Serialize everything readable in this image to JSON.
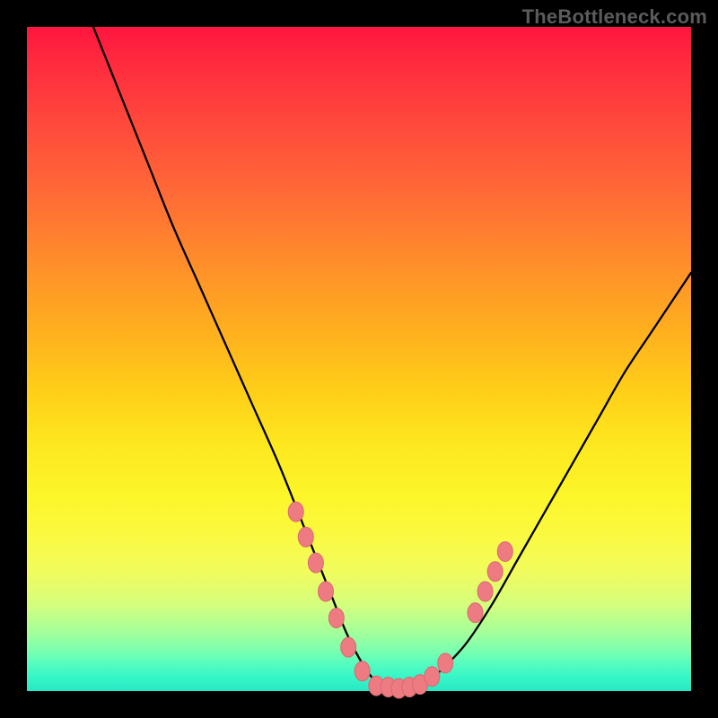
{
  "watermark": "TheBottleneck.com",
  "colors": {
    "frame": "#000000",
    "curve": "#000000",
    "marker_fill": "#ee7a82",
    "marker_stroke": "#d86a72"
  },
  "chart_data": {
    "type": "line",
    "title": "",
    "xlabel": "",
    "ylabel": "",
    "xlim": [
      0,
      100
    ],
    "ylim": [
      0,
      100
    ],
    "series": [
      {
        "name": "curve",
        "x": [
          10,
          14,
          18,
          22,
          26,
          30,
          34,
          38,
          42,
          44,
          46,
          48,
          50,
          52,
          54,
          56,
          58,
          60,
          62,
          66,
          70,
          74,
          78,
          82,
          86,
          90,
          94,
          98,
          100
        ],
        "y": [
          100,
          90,
          80,
          70,
          61,
          52,
          43,
          34,
          24,
          19,
          14,
          9,
          5,
          2,
          0.6,
          0.2,
          0.4,
          1.2,
          2.8,
          7,
          13,
          20,
          27,
          34,
          41,
          48,
          54,
          60,
          63
        ]
      }
    ],
    "markers": [
      {
        "x": 40.5,
        "y": 27.0
      },
      {
        "x": 42.0,
        "y": 23.2
      },
      {
        "x": 43.5,
        "y": 19.3
      },
      {
        "x": 45.0,
        "y": 15.0
      },
      {
        "x": 46.6,
        "y": 11.0
      },
      {
        "x": 48.4,
        "y": 6.6
      },
      {
        "x": 50.5,
        "y": 3.0
      },
      {
        "x": 52.6,
        "y": 0.8
      },
      {
        "x": 54.4,
        "y": 0.6
      },
      {
        "x": 56.0,
        "y": 0.4
      },
      {
        "x": 57.6,
        "y": 0.6
      },
      {
        "x": 59.2,
        "y": 1.0
      },
      {
        "x": 61.0,
        "y": 2.2
      },
      {
        "x": 63.0,
        "y": 4.2
      },
      {
        "x": 67.5,
        "y": 11.8
      },
      {
        "x": 69.0,
        "y": 15.0
      },
      {
        "x": 70.5,
        "y": 18.0
      },
      {
        "x": 72.0,
        "y": 21.0
      }
    ]
  }
}
